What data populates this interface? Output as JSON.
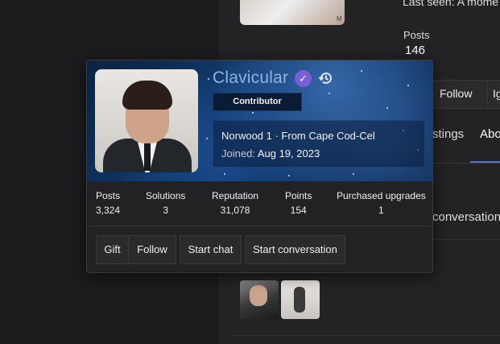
{
  "background_page": {
    "last_seen_text": "Last seen: A mome",
    "posts_label": "Posts",
    "posts_value": "146",
    "follow_label": "Follow",
    "ignore_partial": "Ig",
    "tab_partial_1": "stings",
    "tab_partial_2": "Abo",
    "conversation_partial": "conversation",
    "avatar_mark": "M"
  },
  "card": {
    "username": "Clavicular",
    "verified_icon": "check-badge-icon",
    "history_icon": "history-icon",
    "role_badge": "Contributor",
    "location": "Norwood 1 · From Cape Cod-Cel",
    "joined_label": "Joined: ",
    "joined_date": "Aug 19, 2023",
    "stats": [
      {
        "label": "Posts",
        "value": "3,324"
      },
      {
        "label": "Solutions",
        "value": "3"
      },
      {
        "label": "Reputation",
        "value": "31,078"
      },
      {
        "label": "Points",
        "value": "154"
      },
      {
        "label": "Purchased upgrades",
        "value": "1"
      }
    ],
    "actions": {
      "gift": "Gift",
      "follow": "Follow",
      "start_chat": "Start chat",
      "start_conversation": "Start conversation"
    }
  },
  "colors": {
    "username": "#8fb3e3",
    "verified": "#7b5fd8",
    "tab_accent": "#5a6fd6"
  }
}
